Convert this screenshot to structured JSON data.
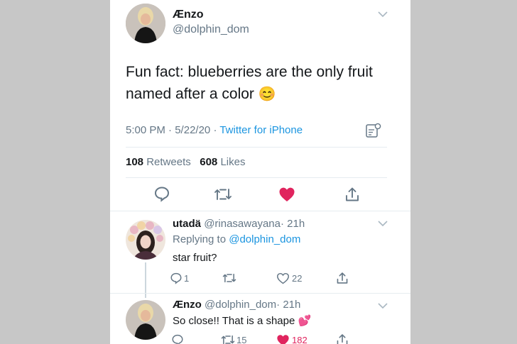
{
  "main_tweet": {
    "display_name": "Ænzo",
    "handle": "@dolphin_dom",
    "text_line1": "Fun fact: blueberries are the only fruit",
    "text_line2": "named after a color",
    "emoji": "😊",
    "time": "5:00 PM",
    "sep1": "·",
    "date": "5/22/20",
    "sep2": "·",
    "source": "Twitter for iPhone",
    "retweets_count": "108",
    "retweets_label": "Retweets",
    "likes_count": "608",
    "likes_label": "Likes"
  },
  "replies": [
    {
      "display_name": "utadä",
      "handle": "@rinasawayana",
      "sep": "·",
      "age": "21h",
      "replying_label": "Replying to",
      "replying_handle": "@dolphin_dom",
      "text": "star fruit?",
      "reply_count": "1",
      "like_count": "22"
    },
    {
      "display_name": "Ænzo",
      "handle": "@dolphin_dom",
      "sep": "·",
      "age": "21h",
      "text": "So close!! That is a shape",
      "emoji": "💕",
      "retweet_count": "15",
      "like_count": "182"
    }
  ],
  "colors": {
    "like_red": "#e0245e",
    "link_blue": "#1b95e0",
    "muted_gray": "#657786"
  }
}
